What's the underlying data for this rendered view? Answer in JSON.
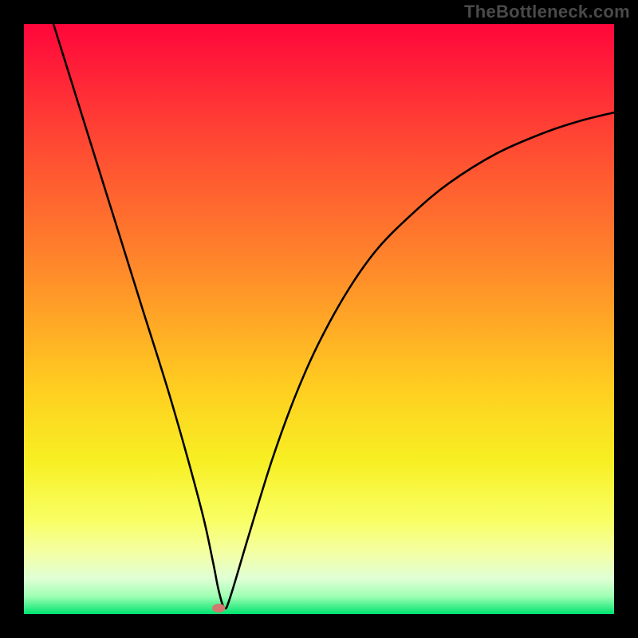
{
  "watermark": "TheBottleneck.com",
  "chart_data": {
    "type": "line",
    "title": "",
    "xlabel": "",
    "ylabel": "",
    "xlim": [
      0,
      100
    ],
    "ylim": [
      0,
      100
    ],
    "grid": false,
    "legend": false,
    "background_gradient": {
      "stops": [
        {
          "pos": 0.0,
          "color": "#ff063b"
        },
        {
          "pos": 0.2,
          "color": "#ff4833"
        },
        {
          "pos": 0.42,
          "color": "#ff8b2a"
        },
        {
          "pos": 0.62,
          "color": "#ffcf20"
        },
        {
          "pos": 0.74,
          "color": "#f7ef23"
        },
        {
          "pos": 0.84,
          "color": "#f9ff63"
        },
        {
          "pos": 0.9,
          "color": "#f3ffa9"
        },
        {
          "pos": 0.94,
          "color": "#dfffd5"
        },
        {
          "pos": 0.97,
          "color": "#9fffb4"
        },
        {
          "pos": 1.0,
          "color": "#00e36e"
        }
      ]
    },
    "series": [
      {
        "name": "bottleneck-curve",
        "color": "#000000",
        "x": [
          5.0,
          10.0,
          15.0,
          20.0,
          25.0,
          30.0,
          32.0,
          33.0,
          34.0,
          35.0,
          38.0,
          42.0,
          46.0,
          50.0,
          55.0,
          60.0,
          66.0,
          72.0,
          80.0,
          88.0,
          94.0,
          100.0
        ],
        "y": [
          100.0,
          84.0,
          68.0,
          52.0,
          36.0,
          18.0,
          9.0,
          4.0,
          1.0,
          3.0,
          13.0,
          26.0,
          37.0,
          46.0,
          55.0,
          62.0,
          68.0,
          73.0,
          78.0,
          81.5,
          83.5,
          85.0
        ]
      }
    ],
    "marker": {
      "name": "optimal-point",
      "x": 33.0,
      "y": 1.0,
      "rx": 1.1,
      "ry": 0.75,
      "fill": "#d2786e"
    }
  }
}
